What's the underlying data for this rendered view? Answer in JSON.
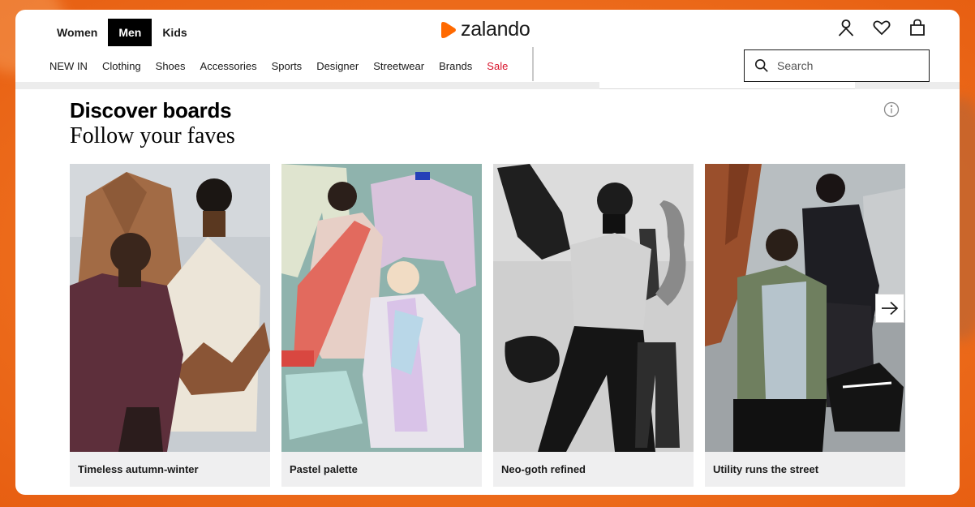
{
  "colors": {
    "brand": "#ff6900",
    "sale": "#d8132b",
    "background": "#ee6f1e"
  },
  "gender_tabs": [
    {
      "label": "Women",
      "active": false
    },
    {
      "label": "Men",
      "active": true
    },
    {
      "label": "Kids",
      "active": false
    }
  ],
  "logo": {
    "text": "zalando",
    "icon": "zalando-play-logo-icon"
  },
  "top_icons": [
    "user-icon",
    "heart-icon",
    "shopping-bag-icon"
  ],
  "categories": [
    "NEW IN",
    "Clothing",
    "Shoes",
    "Accessories",
    "Sports",
    "Designer",
    "Streetwear",
    "Brands",
    "Sale"
  ],
  "search": {
    "placeholder": "Search",
    "value": "",
    "icon": "search-icon"
  },
  "section": {
    "title": "Discover boards",
    "subtitle": "Follow your faves",
    "info_icon": "info-icon"
  },
  "boards": [
    {
      "label": "Timeless autumn-winter",
      "image": "autumn-winter-collage"
    },
    {
      "label": "Pastel palette",
      "image": "pastel-collage"
    },
    {
      "label": "Neo-goth refined",
      "image": "monochrome-collage"
    },
    {
      "label": "Utility runs the street",
      "image": "utility-street-collage"
    }
  ],
  "carousel": {
    "next_icon": "arrow-right-icon"
  }
}
